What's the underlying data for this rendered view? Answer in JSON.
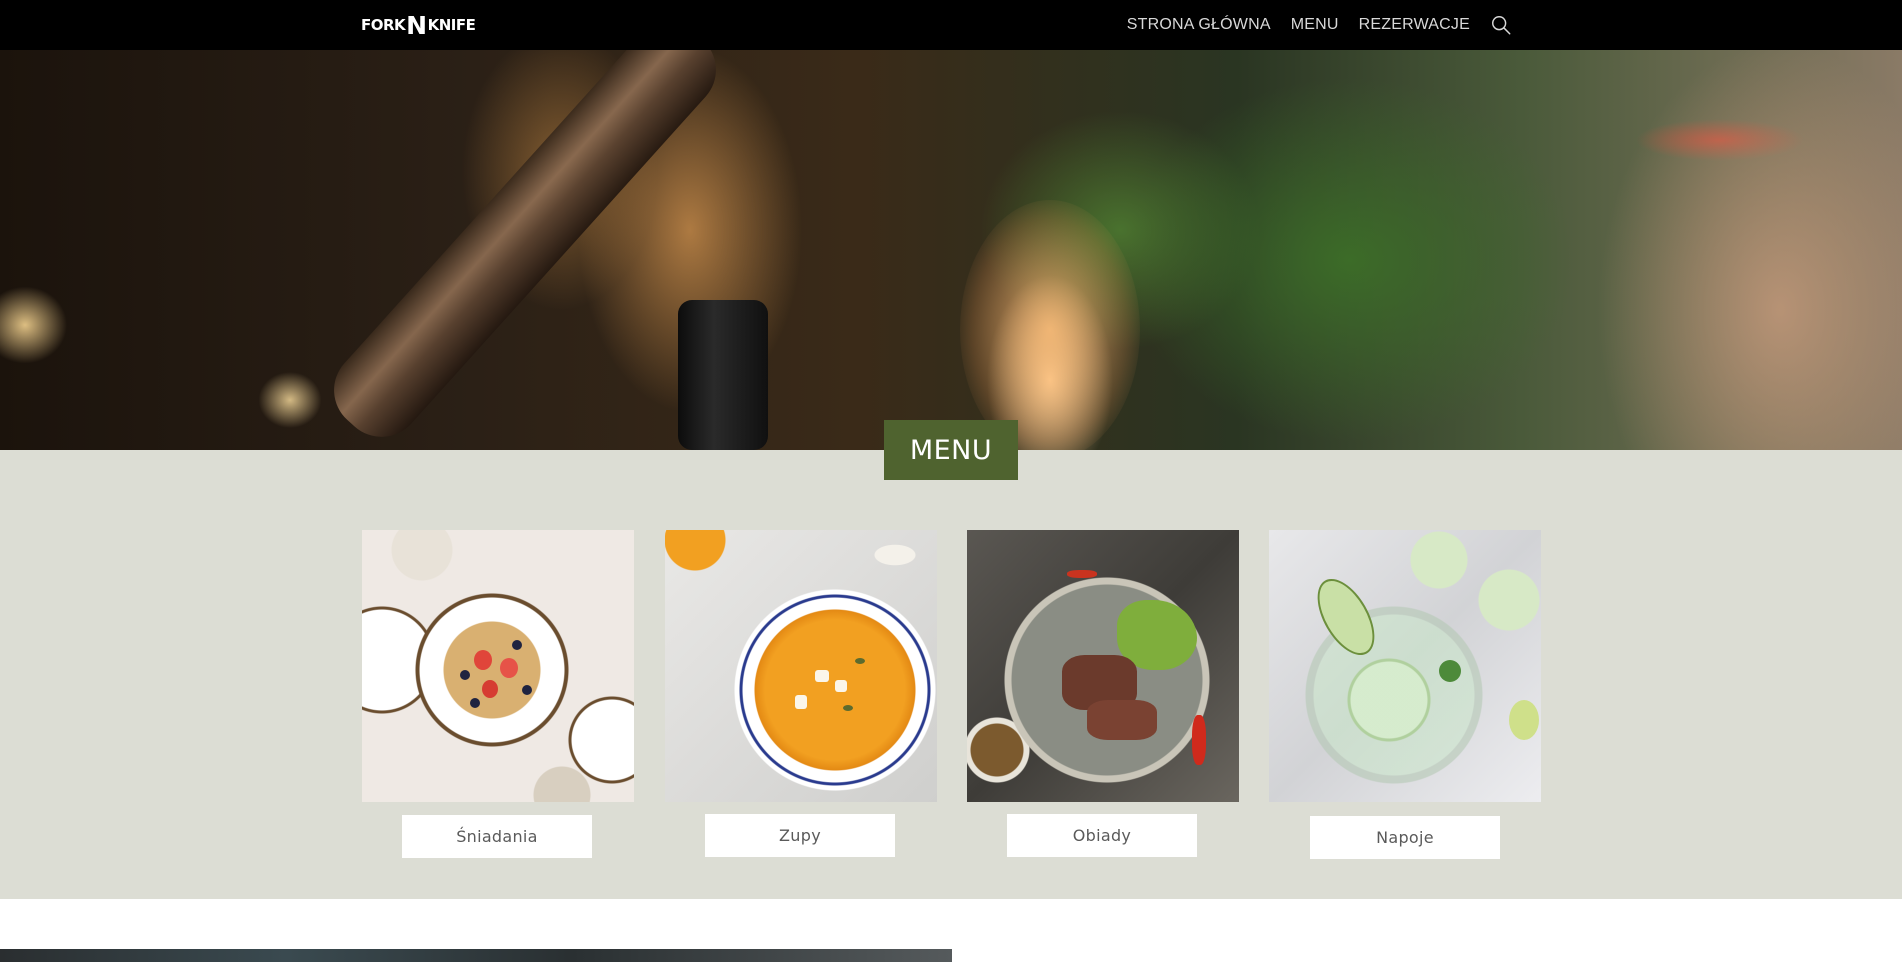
{
  "nav": {
    "logo_left": "FORK",
    "logo_mid": "N",
    "logo_right": "KNIFE",
    "links": [
      "STRONA GŁÓWNA",
      "MENU",
      "REZERWACJE"
    ],
    "search_icon": "search-icon"
  },
  "hero": {
    "image": "restaurant-interior-lamp-plants"
  },
  "menu": {
    "title": "MENU",
    "categories": [
      {
        "label": "Śniadania",
        "image": "waffles-breakfast"
      },
      {
        "label": "Zupy",
        "image": "pumpkin-soup"
      },
      {
        "label": "Obiady",
        "image": "steak-salad-dinner"
      },
      {
        "label": "Napoje",
        "image": "cucumber-drink"
      }
    ]
  },
  "colors": {
    "nav_bg": "#000000",
    "menu_bg": "#dcddd4",
    "accent_green": "#4f632f",
    "nav_text": "#d8d8d8"
  }
}
